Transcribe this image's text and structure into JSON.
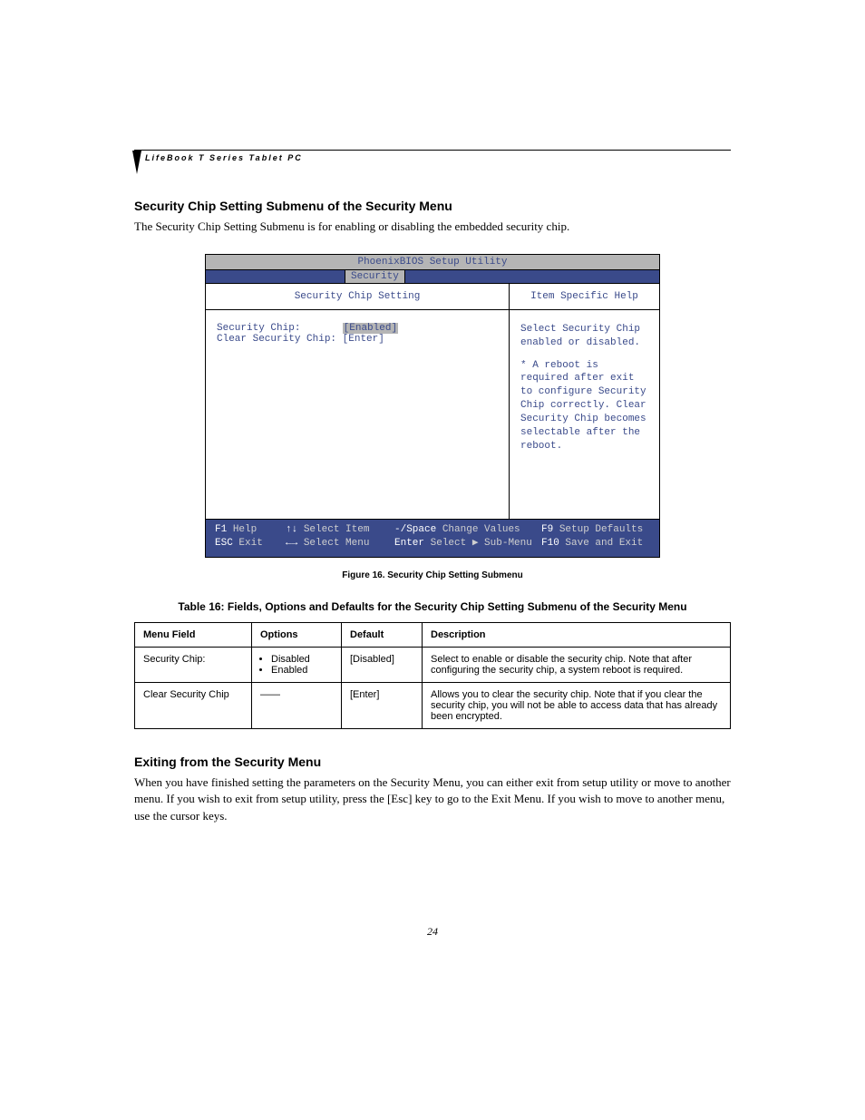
{
  "header": {
    "product_label": "LifeBook T Series Tablet PC"
  },
  "section1": {
    "heading": "Security Chip Setting Submenu of the Security Menu",
    "body": "The Security Chip Setting Submenu is for enabling or disabling the embedded security chip."
  },
  "bios": {
    "title": "PhoenixBIOS Setup Utility",
    "active_tab": "Security",
    "left_header": "Security Chip Setting",
    "right_header": "Item Specific Help",
    "fields": {
      "row1_label": "Security Chip:",
      "row1_value": "[Enabled]",
      "row2_label": "Clear Security Chip:",
      "row2_value": "[Enter]"
    },
    "help": {
      "p1": "Select Security Chip enabled or disabled.",
      "p2": "* A reboot is required after exit to configure Security Chip correctly. Clear Security Chip becomes selectable after the reboot."
    },
    "footer": {
      "f1_key": "F1",
      "f1_label": "Help",
      "esc_key": "ESC",
      "esc_label": "Exit",
      "updown": "↑↓",
      "selitem": "Select Item",
      "leftright": "←→",
      "selmenu": "Select Menu",
      "minussp_key": "-/Space",
      "changevals": "Change Values",
      "enter_key": "Enter",
      "selsub": "Select ▶ Sub-Menu",
      "f9_key": "F9",
      "f9_label": "Setup Defaults",
      "f10_key": "F10",
      "f10_label": "Save and Exit"
    }
  },
  "figure_caption": "Figure 16.   Security Chip Setting Submenu",
  "table_caption": "Table 16: Fields, Options and Defaults for the Security Chip Setting Submenu of the Security Menu",
  "table": {
    "headers": {
      "c1": "Menu Field",
      "c2": "Options",
      "c3": "Default",
      "c4": "Description"
    },
    "rows": [
      {
        "field": "Security Chip:",
        "options": [
          "Disabled",
          "Enabled"
        ],
        "default": "[Disabled]",
        "desc": "Select to enable or disable the security chip. Note that after configuring the security chip, a system reboot is required."
      },
      {
        "field": "Clear Security Chip",
        "options_dash": "——",
        "default": "[Enter]",
        "desc": "Allows you to clear the security chip. Note that if you clear the security chip, you will not be able to access data that has already been encrypted."
      }
    ]
  },
  "section2": {
    "heading": "Exiting from the Security Menu",
    "body": "When you have finished setting the parameters on the Security Menu, you can either exit from setup utility or move to another menu. If you wish to exit from setup utility, press the [Esc] key to go to the Exit Menu. If you wish to move to another menu, use the cursor keys."
  },
  "page_number": "24"
}
